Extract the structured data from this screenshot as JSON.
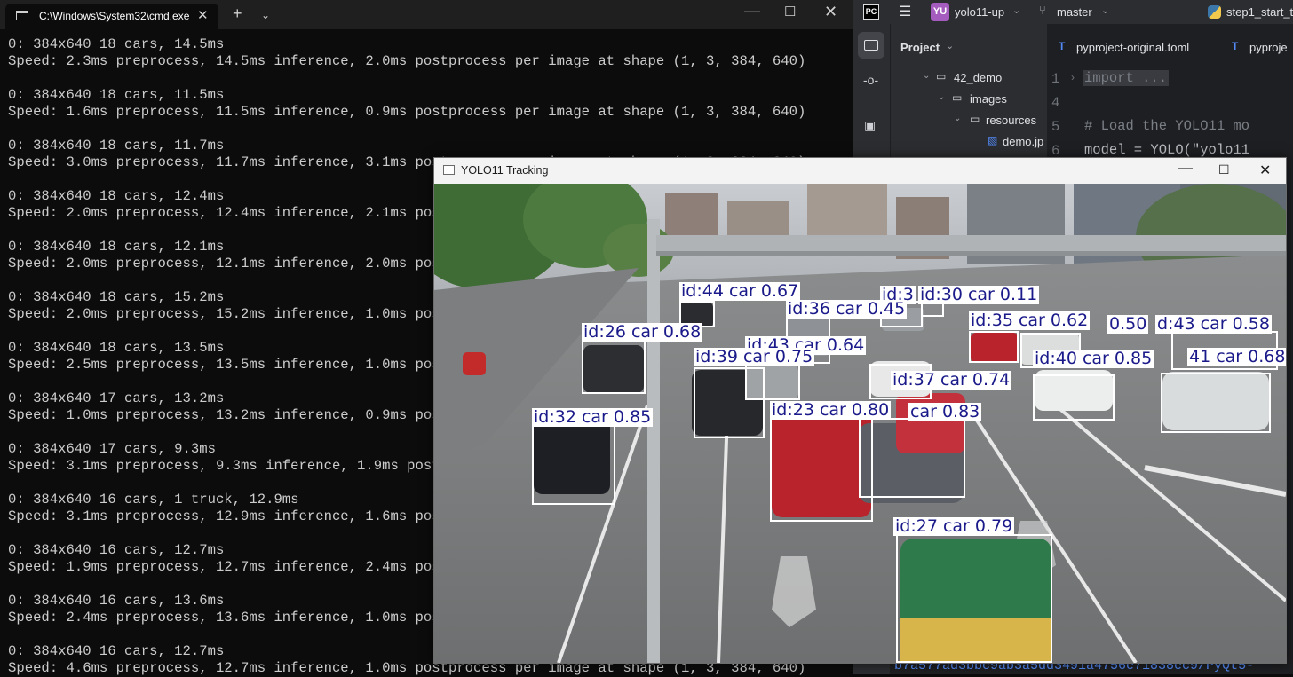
{
  "cmd": {
    "tab_title": "C:\\Windows\\System32\\cmd.exe",
    "lines": [
      "0: 384x640 18 cars, 14.5ms",
      "Speed: 2.3ms preprocess, 14.5ms inference, 2.0ms postprocess per image at shape (1, 3, 384, 640)",
      "0: 384x640 18 cars, 11.5ms",
      "Speed: 1.6ms preprocess, 11.5ms inference, 0.9ms postprocess per image at shape (1, 3, 384, 640)",
      "0: 384x640 18 cars, 11.7ms",
      "Speed: 3.0ms preprocess, 11.7ms inference, 3.1ms postprocess per image at shape (1, 3, 384, 640)",
      "0: 384x640 18 cars, 12.4ms",
      "Speed: 2.0ms preprocess, 12.4ms inference, 2.1ms postprocess per image at shape (1, 3, 384, 640)",
      "0: 384x640 18 cars, 12.1ms",
      "Speed: 2.0ms preprocess, 12.1ms inference, 2.0ms postprocess per image at shape (1, 3, 384, 640)",
      "0: 384x640 18 cars, 15.2ms",
      "Speed: 2.0ms preprocess, 15.2ms inference, 1.0ms postprocess per image at shape (1, 3, 384, 640)",
      "0: 384x640 18 cars, 13.5ms",
      "Speed: 2.5ms preprocess, 13.5ms inference, 1.0ms postprocess per image at shape (1, 3, 384, 640)",
      "0: 384x640 17 cars, 13.2ms",
      "Speed: 1.0ms preprocess, 13.2ms inference, 0.9ms postprocess per image at shape (1, 3, 384, 640)",
      "0: 384x640 17 cars, 9.3ms",
      "Speed: 3.1ms preprocess, 9.3ms inference, 1.9ms postprocess per image at shape (1, 3, 384, 640)",
      "0: 384x640 16 cars, 1 truck, 12.9ms",
      "Speed: 3.1ms preprocess, 12.9ms inference, 1.6ms postprocess per image at shape (1, 3, 384, 640)",
      "0: 384x640 16 cars, 12.7ms",
      "Speed: 1.9ms preprocess, 12.7ms inference, 2.4ms postprocess per image at shape (1, 3, 384, 640)",
      "0: 384x640 16 cars, 13.6ms",
      "Speed: 2.4ms preprocess, 13.6ms inference, 1.0ms postprocess per image at shape (1, 3, 384, 640)",
      "0: 384x640 16 cars, 12.7ms",
      "Speed: 4.6ms preprocess, 12.7ms inference, 1.0ms postprocess per image at shape (1, 3, 384, 640)"
    ]
  },
  "ide": {
    "project_badge": "YU",
    "project_name": "yolo11-up",
    "branch": "master",
    "run_config": "step1_start_t",
    "project_label": "Project",
    "tree": [
      "42_demo",
      "images",
      "resources",
      "demo.jp"
    ],
    "tabs": [
      "pyproject-original.toml",
      "pyproje"
    ],
    "line_numbers": [
      "1",
      "4",
      "5",
      "6"
    ],
    "code": [
      "import ...",
      "# Load the YOLO11 mo",
      "model = YOLO(\"yolo11"
    ],
    "bottom_hash": "b7a577ad3bbc9ab3a5dd3491a4756e71838ec9/PyQt5-"
  },
  "yolo": {
    "title": "YOLO11 Tracking",
    "detections": [
      {
        "label": "id:44 car 0.67"
      },
      {
        "label": "id:3"
      },
      {
        "label": "id:30 car 0.11"
      },
      {
        "label": "id:36 car 0.45"
      },
      {
        "label": "id:35 car 0.62"
      },
      {
        "label": "0.50"
      },
      {
        "label": "d:43 car 0.58"
      },
      {
        "label": "id:26 car 0.68"
      },
      {
        "label": "id:43 car 0.64"
      },
      {
        "label": "id:39 car 0.75"
      },
      {
        "label": "id:40 car 0.85"
      },
      {
        "label": "41 car 0.68"
      },
      {
        "label": "id:37 car 0.74"
      },
      {
        "label": "id:32 car 0.85"
      },
      {
        "label": "id:23 car 0.80"
      },
      {
        "label": "car 0.83"
      },
      {
        "label": "id:27 car 0.79"
      }
    ]
  }
}
